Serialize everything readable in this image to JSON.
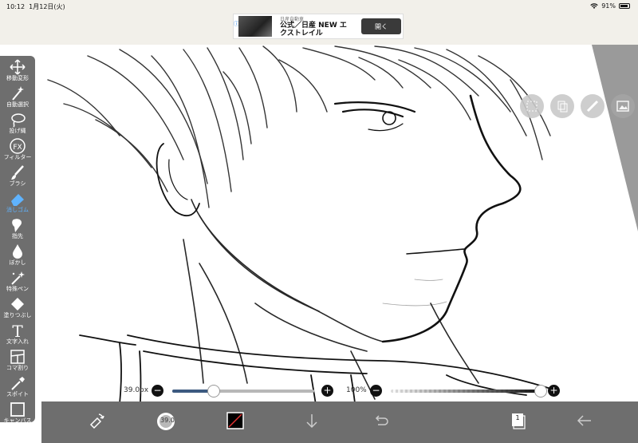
{
  "status": {
    "time": "10:12",
    "date": "1月12日(火)",
    "battery_pct": "91%"
  },
  "ad": {
    "sponsor": "日産自動車",
    "headline": "公式／日産 NEW エクストレイル",
    "open_label": "開く",
    "info_mark": "ⓘ✕"
  },
  "tools": [
    {
      "label": "移動変形",
      "icon": "move-icon"
    },
    {
      "label": "自動選択",
      "icon": "magic-wand-icon"
    },
    {
      "label": "投げ縄",
      "icon": "lasso-icon"
    },
    {
      "label": "フィルター",
      "icon": "fx-icon"
    },
    {
      "label": "ブラシ",
      "icon": "brush-icon"
    },
    {
      "label": "消しゴム",
      "icon": "eraser-icon",
      "active": true
    },
    {
      "label": "指先",
      "icon": "finger-icon"
    },
    {
      "label": "ぼかし",
      "icon": "blur-icon"
    },
    {
      "label": "特殊ペン",
      "icon": "special-pen-icon"
    },
    {
      "label": "塗りつぶし",
      "icon": "fill-icon"
    },
    {
      "label": "文字入れ",
      "icon": "text-icon"
    },
    {
      "label": "コマ割り",
      "icon": "frame-divider-icon"
    },
    {
      "label": "スポイト",
      "icon": "eyedropper-icon"
    },
    {
      "label": "キャンバス",
      "icon": "canvas-icon"
    }
  ],
  "brush_size": {
    "label": "39.0px",
    "value": 39.0,
    "fraction": 0.29
  },
  "opacity": {
    "label": "100%",
    "value": 100,
    "fraction": 1.0
  },
  "bottom": {
    "brush_preview_label": "39.0",
    "layers_count": "1"
  },
  "colors": {
    "toolbar": "#6e6e6e",
    "accent": "#5fb3ff",
    "size_fill": "#3c5a80"
  }
}
